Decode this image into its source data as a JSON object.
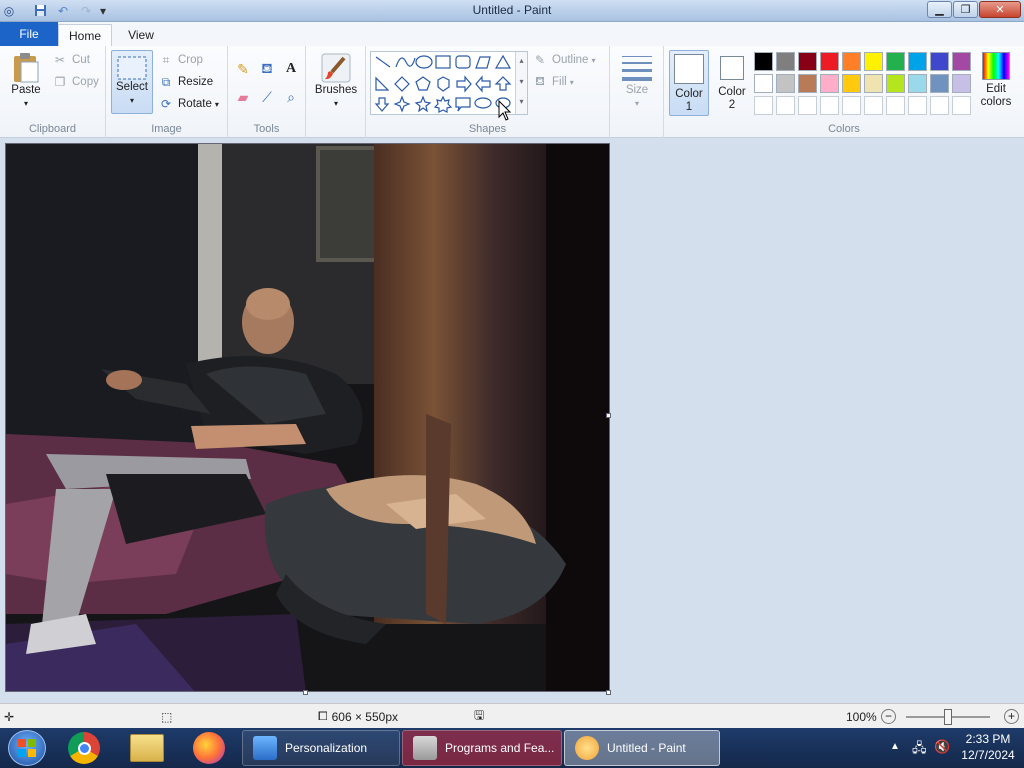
{
  "window": {
    "title": "Untitled - Paint"
  },
  "menu": {
    "file": "File",
    "home": "Home",
    "view": "View"
  },
  "clipboard": {
    "paste": "Paste",
    "cut": "Cut",
    "copy": "Copy",
    "group": "Clipboard"
  },
  "image": {
    "select": "Select",
    "crop": "Crop",
    "resize": "Resize",
    "rotate": "Rotate",
    "group": "Image"
  },
  "tools": {
    "group": "Tools"
  },
  "brushes": {
    "label": "Brushes"
  },
  "shapes": {
    "outline": "Outline",
    "fill": "Fill",
    "group": "Shapes"
  },
  "size": {
    "label": "Size"
  },
  "colors": {
    "color1": "Color 1",
    "color2": "Color 2",
    "edit": "Edit colors",
    "group": "Colors",
    "color1_value": "#ffffff",
    "color2_value": "#ffffff",
    "palette_row1": [
      "#000000",
      "#7f7f7f",
      "#880015",
      "#ed1c24",
      "#ff7f27",
      "#fff200",
      "#22b14c",
      "#00a2e8",
      "#3f48cc",
      "#a349a4"
    ],
    "palette_row2": [
      "#ffffff",
      "#c3c3c3",
      "#b97a57",
      "#ffaec9",
      "#ffc90e",
      "#efe4b0",
      "#b5e61d",
      "#99d9ea",
      "#7092be",
      "#c8bfe7"
    ],
    "palette_row3": [
      "#ffffff",
      "#ffffff",
      "#ffffff",
      "#ffffff",
      "#ffffff",
      "#ffffff",
      "#ffffff",
      "#ffffff",
      "#ffffff",
      "#ffffff"
    ]
  },
  "status": {
    "dimensions": "606 × 550px",
    "zoom": "100%"
  },
  "taskbar": {
    "items": [
      "Personalization",
      "Programs and Fea...",
      "Untitled - Paint"
    ],
    "time": "2:33 PM",
    "date": "12/7/2024"
  }
}
